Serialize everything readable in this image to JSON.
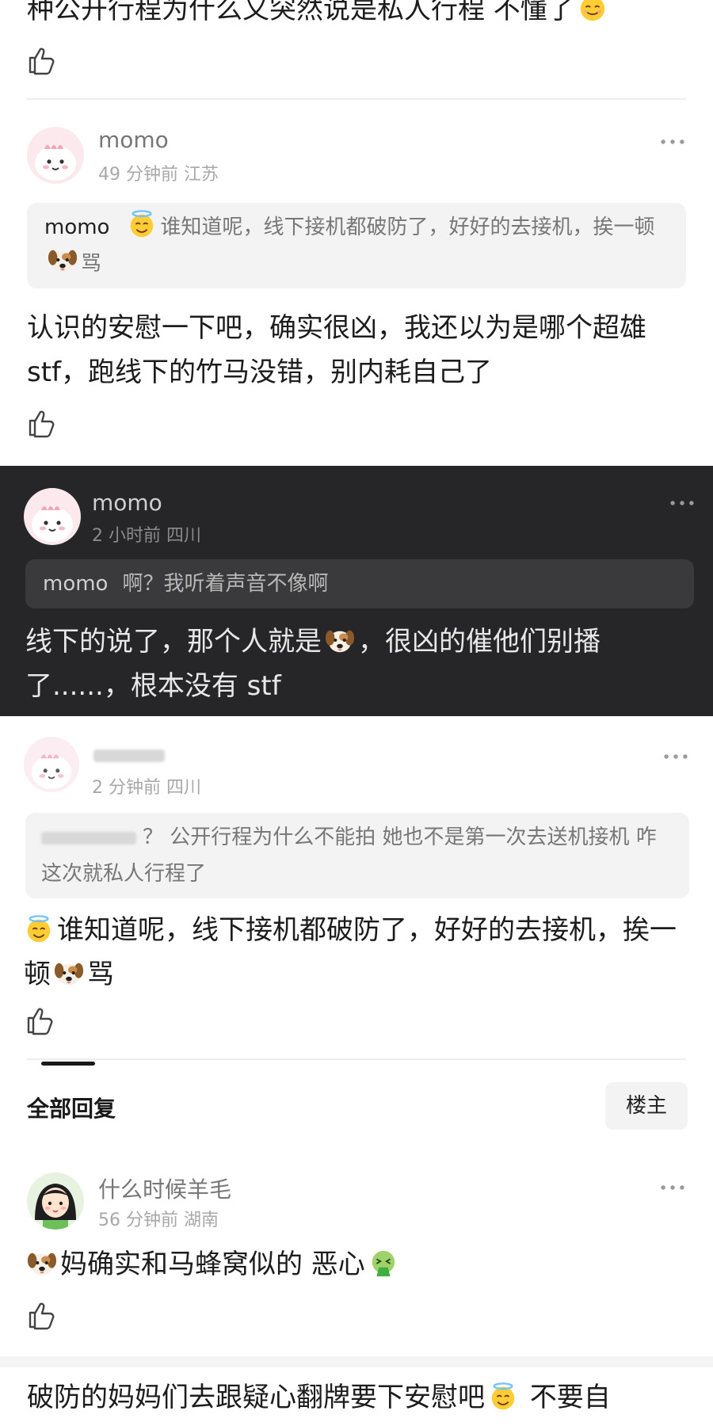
{
  "top_comment": {
    "text_tail": "种公开行程为什么又突然说是私人行程 不懂了"
  },
  "comments": [
    {
      "name": "momo",
      "time_location": "49 分钟前  江苏",
      "quote_name": "momo",
      "quote_text": "谁知道呢，线下接机都破防了，好好的去接机，挨一顿",
      "quote_tail": "骂",
      "body": "认识的安慰一下吧，确实很凶，我还以为是哪个超雄stf，跑线下的竹马没错，别内耗自己了"
    },
    {
      "name": "momo",
      "time_location": "2 小时前  四川",
      "quote_name": "momo",
      "quote_text": "啊？我听着声音不像啊",
      "body_part1": "线下的说了，那个人就是",
      "body_part2": "，很凶的催他们别播了......，根本没有 stf"
    },
    {
      "time_location": "2 分钟前  四川",
      "quote_text": "？ 公开行程为什么不能拍 她也不是第一次去送机接机 咋这次就私人行程了",
      "body_part1": "谁知道呢，线下接机都破防了，好好的去接机，挨一顿",
      "body_part2": "骂"
    }
  ],
  "replies_section": {
    "title": "全部回复",
    "owner_button": "楼主"
  },
  "reply": {
    "name": "什么时候羊毛",
    "time_location": "56 分钟前  湖南",
    "body_part1": "妈确实和马蜂窝似的 恶心"
  },
  "bottom_comment": {
    "text_part1": "破防的妈妈们去跟疑心翻牌要下安慰吧",
    "text_part2": "不要自"
  },
  "icons": {
    "more": "more-dots-icon",
    "like": "thumbs-up-icon",
    "smile": "smiling-face-emoji",
    "angel": "angel-face-emoji",
    "dog": "dog-face-emoji",
    "vomit": "vomiting-face-emoji"
  },
  "colors": {
    "dark_bg": "#262628",
    "quote_bg": "#f3f3f3",
    "meta_gray": "#a8a8a8"
  }
}
